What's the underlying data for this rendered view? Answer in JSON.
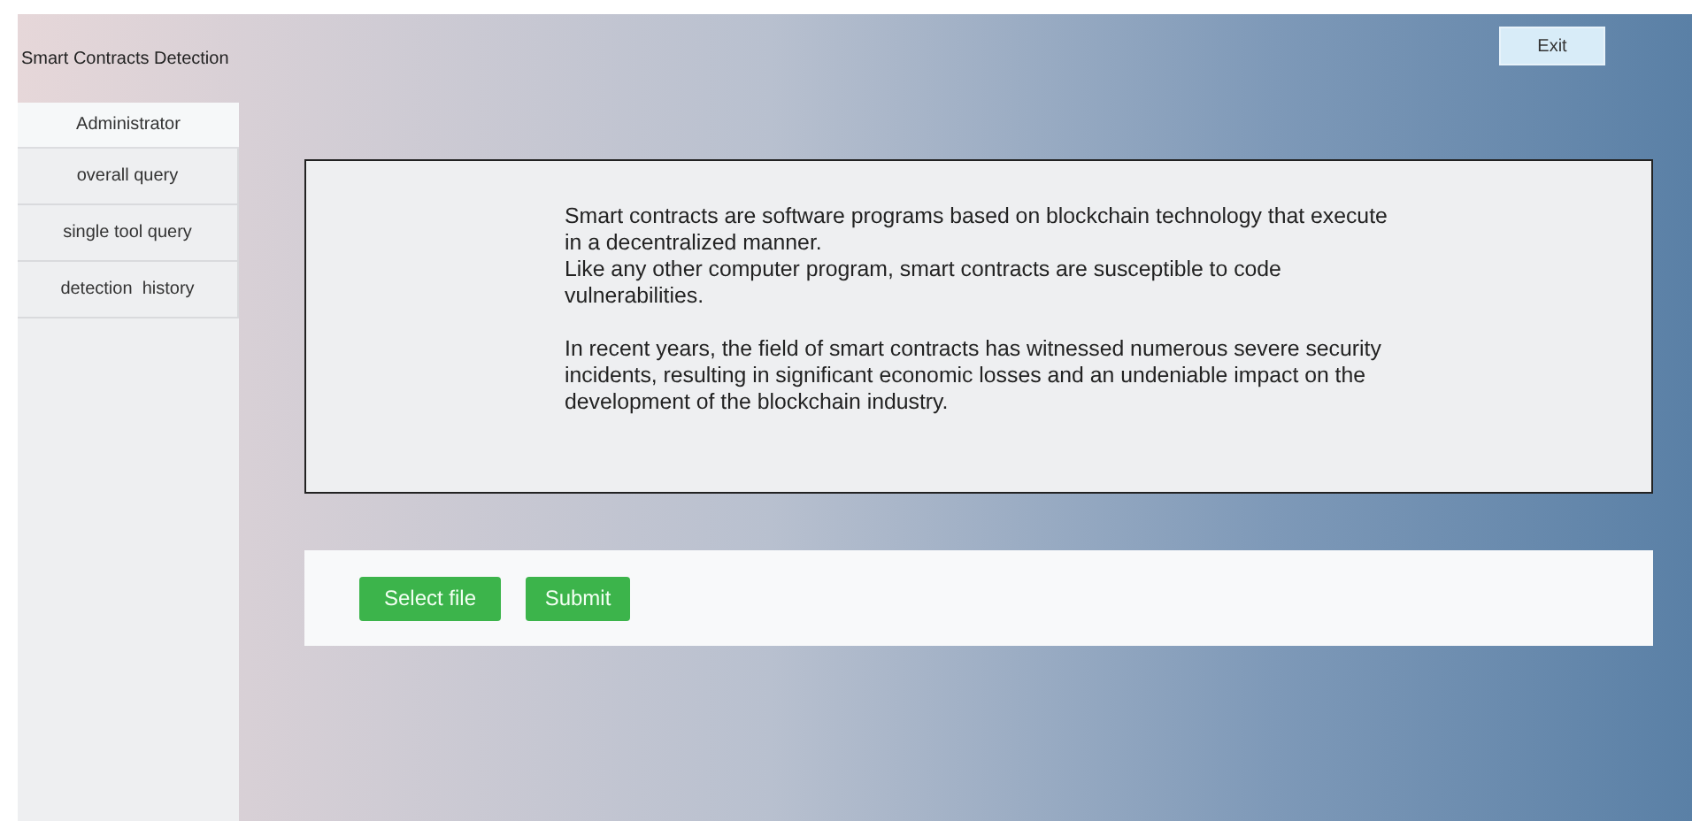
{
  "header": {
    "title": "Smart Contracts Detection",
    "exit_button": "Exit"
  },
  "sidebar": {
    "user": "Administrator",
    "items": [
      {
        "label": "overall query"
      },
      {
        "label": "single tool query"
      },
      {
        "label": "detection  history"
      }
    ]
  },
  "intro": {
    "paragraphs": [
      "Smart contracts are software programs based on blockchain technology that execute in a decentralized manner.",
      "Like any other computer program, smart contracts are susceptible to code vulnerabilities.",
      "In recent years, the field of smart contracts has witnessed numerous severe security incidents, resulting in significant economic losses and an undeniable impact on the development of the blockchain industry."
    ]
  },
  "upload": {
    "buttons": [
      "Select file",
      "Submit"
    ]
  }
}
